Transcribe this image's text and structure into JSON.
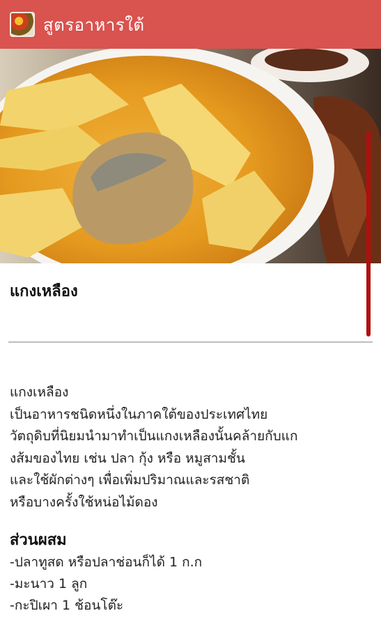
{
  "app": {
    "title": "สูตรอาหารใต้",
    "bar_color": "#d9534f",
    "icon": "food-thumbnail-icon"
  },
  "recipe": {
    "image_alt": "food-photo",
    "name": "แกงเหลือง",
    "description": "แกงเหลือง\nเป็นอาหารชนิดหนึ่งในภาคใต้ของประเทศไทย\nวัตถุดิบที่นิยมนำมาทำเป็นแกงเหลืองนั้นคล้ายกับแก\nงส้มของไทย เช่น ปลา กุ้ง หรือ หมูสามชั้น\nและใช้ผักต่างๆ เพื่อเพิ่มปริมาณและรสชาติ\nหรือบางครั้งใช้หน่อไม้ดอง",
    "ingredients_heading": "ส่วนผสม",
    "ingredients": [
      "-ปลาทูสด หรือปลาช่อนก็ได้ 1 ก.ก",
      "-มะนาว 1 ลูก",
      "-กะปิเผา 1 ช้อนโต๊ะ"
    ]
  },
  "accent_scroll_color": "#b20f0f"
}
